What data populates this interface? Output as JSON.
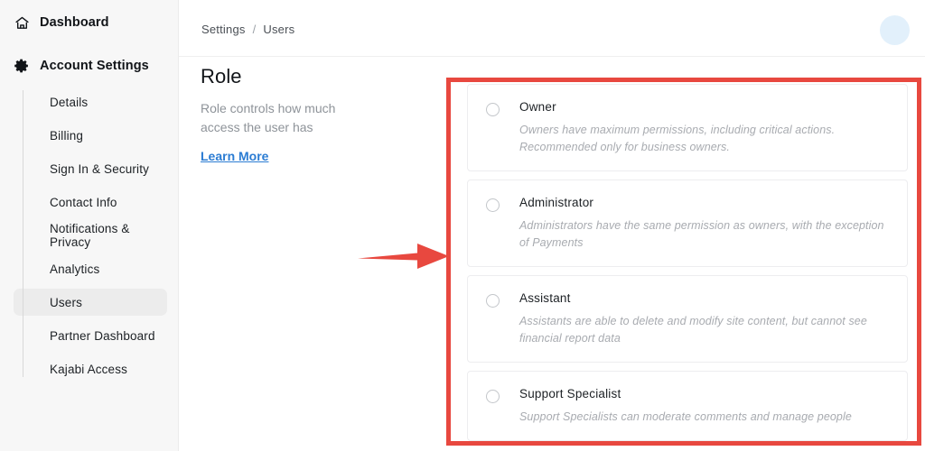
{
  "sidebar": {
    "top_items": [
      {
        "label": "Dashboard",
        "icon": "home-icon"
      },
      {
        "label": "Account Settings",
        "icon": "gear-icon"
      }
    ],
    "sub_items": [
      {
        "label": "Details",
        "active": false
      },
      {
        "label": "Billing",
        "active": false
      },
      {
        "label": "Sign In & Security",
        "active": false
      },
      {
        "label": "Contact Info",
        "active": false
      },
      {
        "label": "Notifications & Privacy",
        "active": false
      },
      {
        "label": "Analytics",
        "active": false
      },
      {
        "label": "Users",
        "active": true
      },
      {
        "label": "Partner Dashboard",
        "active": false
      },
      {
        "label": "Kajabi Access",
        "active": false
      }
    ]
  },
  "topbar": {
    "breadcrumb": {
      "parent": "Settings",
      "separator": "/",
      "current": "Users"
    },
    "avatar": {
      "icon": "avatar",
      "color": "#e2f0fb"
    }
  },
  "role_info": {
    "title": "Role",
    "description": "Role controls how much access the user has",
    "learn_more": "Learn More"
  },
  "annotation": {
    "color": "#e8483f",
    "arrow_icon": "arrow-right-icon",
    "box_icon": "highlight-box"
  },
  "roles": [
    {
      "name": "Owner",
      "description": "Owners have maximum permissions, including critical actions. Recommended only for business owners.",
      "selected": false
    },
    {
      "name": "Administrator",
      "description": "Administrators have the same permission as owners, with the exception of Payments",
      "selected": false
    },
    {
      "name": "Assistant",
      "description": "Assistants are able to delete and modify site content, but cannot see financial report data",
      "selected": false
    },
    {
      "name": "Support Specialist",
      "description": "Support Specialists can moderate comments and manage people",
      "selected": false
    }
  ]
}
